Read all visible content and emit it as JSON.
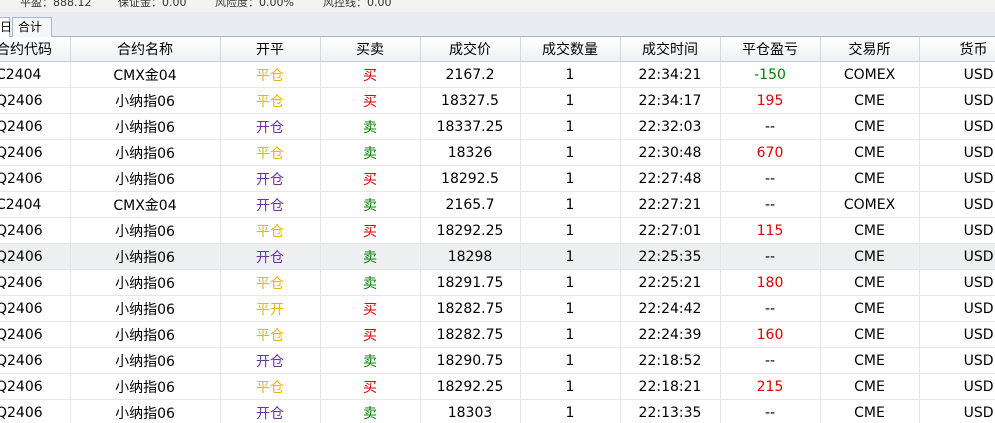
{
  "summary": {
    "items": [
      {
        "label": "平盈：",
        "value": "888.12"
      },
      {
        "label": "保证金：",
        "value": "0.00"
      },
      {
        "label": "风险度：",
        "value": "0.00%"
      },
      {
        "label": "风控线：",
        "value": "0.00"
      }
    ]
  },
  "tabs": [
    {
      "label": "日"
    },
    {
      "label": "合计"
    }
  ],
  "colors": {
    "close": "#e6b800",
    "open": "#7030a0",
    "buy": "#e00000",
    "sell": "#008000",
    "pnl_positive": "#e00000",
    "pnl_negative": "#008000"
  },
  "table": {
    "columns": [
      "合约代码",
      "合约名称",
      "开平",
      "买卖",
      "成交价",
      "成交数量",
      "成交时间",
      "平仓盈亏",
      "交易所",
      "货币"
    ],
    "selected_row": 7,
    "rows": [
      {
        "code": "C2404",
        "name": "CMX金04",
        "offset": "平仓",
        "offset_type": "close",
        "side": "买",
        "side_type": "buy",
        "price": "2167.2",
        "qty": "1",
        "time": "22:34:21",
        "pnl": "-150",
        "exchange": "COMEX",
        "currency": "USD"
      },
      {
        "code": "Q2406",
        "name": "小纳指06",
        "offset": "平仓",
        "offset_type": "close",
        "side": "买",
        "side_type": "buy",
        "price": "18327.5",
        "qty": "1",
        "time": "22:34:17",
        "pnl": "195",
        "exchange": "CME",
        "currency": "USD"
      },
      {
        "code": "Q2406",
        "name": "小纳指06",
        "offset": "开仓",
        "offset_type": "open",
        "side": "卖",
        "side_type": "sell",
        "price": "18337.25",
        "qty": "1",
        "time": "22:32:03",
        "pnl": "--",
        "exchange": "CME",
        "currency": "USD"
      },
      {
        "code": "Q2406",
        "name": "小纳指06",
        "offset": "平仓",
        "offset_type": "close",
        "side": "卖",
        "side_type": "sell",
        "price": "18326",
        "qty": "1",
        "time": "22:30:48",
        "pnl": "670",
        "exchange": "CME",
        "currency": "USD"
      },
      {
        "code": "Q2406",
        "name": "小纳指06",
        "offset": "开仓",
        "offset_type": "open",
        "side": "买",
        "side_type": "buy",
        "price": "18292.5",
        "qty": "1",
        "time": "22:27:48",
        "pnl": "--",
        "exchange": "CME",
        "currency": "USD"
      },
      {
        "code": "C2404",
        "name": "CMX金04",
        "offset": "开仓",
        "offset_type": "open",
        "side": "卖",
        "side_type": "sell",
        "price": "2165.7",
        "qty": "1",
        "time": "22:27:21",
        "pnl": "--",
        "exchange": "COMEX",
        "currency": "USD"
      },
      {
        "code": "Q2406",
        "name": "小纳指06",
        "offset": "平仓",
        "offset_type": "close",
        "side": "买",
        "side_type": "buy",
        "price": "18292.25",
        "qty": "1",
        "time": "22:27:01",
        "pnl": "115",
        "exchange": "CME",
        "currency": "USD"
      },
      {
        "code": "Q2406",
        "name": "小纳指06",
        "offset": "开仓",
        "offset_type": "open",
        "side": "卖",
        "side_type": "sell",
        "price": "18298",
        "qty": "1",
        "time": "22:25:35",
        "pnl": "--",
        "exchange": "CME",
        "currency": "USD"
      },
      {
        "code": "Q2406",
        "name": "小纳指06",
        "offset": "平仓",
        "offset_type": "close",
        "side": "卖",
        "side_type": "sell",
        "price": "18291.75",
        "qty": "1",
        "time": "22:25:21",
        "pnl": "180",
        "exchange": "CME",
        "currency": "USD"
      },
      {
        "code": "Q2406",
        "name": "小纳指06",
        "offset": "平开",
        "offset_type": "close",
        "side": "买",
        "side_type": "buy",
        "price": "18282.75",
        "qty": "1",
        "time": "22:24:42",
        "pnl": "--",
        "exchange": "CME",
        "currency": "USD"
      },
      {
        "code": "Q2406",
        "name": "小纳指06",
        "offset": "平仓",
        "offset_type": "close",
        "side": "买",
        "side_type": "buy",
        "price": "18282.75",
        "qty": "1",
        "time": "22:24:39",
        "pnl": "160",
        "exchange": "CME",
        "currency": "USD"
      },
      {
        "code": "Q2406",
        "name": "小纳指06",
        "offset": "开仓",
        "offset_type": "open",
        "side": "卖",
        "side_type": "sell",
        "price": "18290.75",
        "qty": "1",
        "time": "22:18:52",
        "pnl": "--",
        "exchange": "CME",
        "currency": "USD"
      },
      {
        "code": "Q2406",
        "name": "小纳指06",
        "offset": "平仓",
        "offset_type": "close",
        "side": "买",
        "side_type": "buy",
        "price": "18292.25",
        "qty": "1",
        "time": "22:18:21",
        "pnl": "215",
        "exchange": "CME",
        "currency": "USD"
      },
      {
        "code": "Q2406",
        "name": "小纳指06",
        "offset": "开仓",
        "offset_type": "open",
        "side": "卖",
        "side_type": "sell",
        "price": "18303",
        "qty": "1",
        "time": "22:13:35",
        "pnl": "--",
        "exchange": "CME",
        "currency": "USD"
      }
    ]
  }
}
